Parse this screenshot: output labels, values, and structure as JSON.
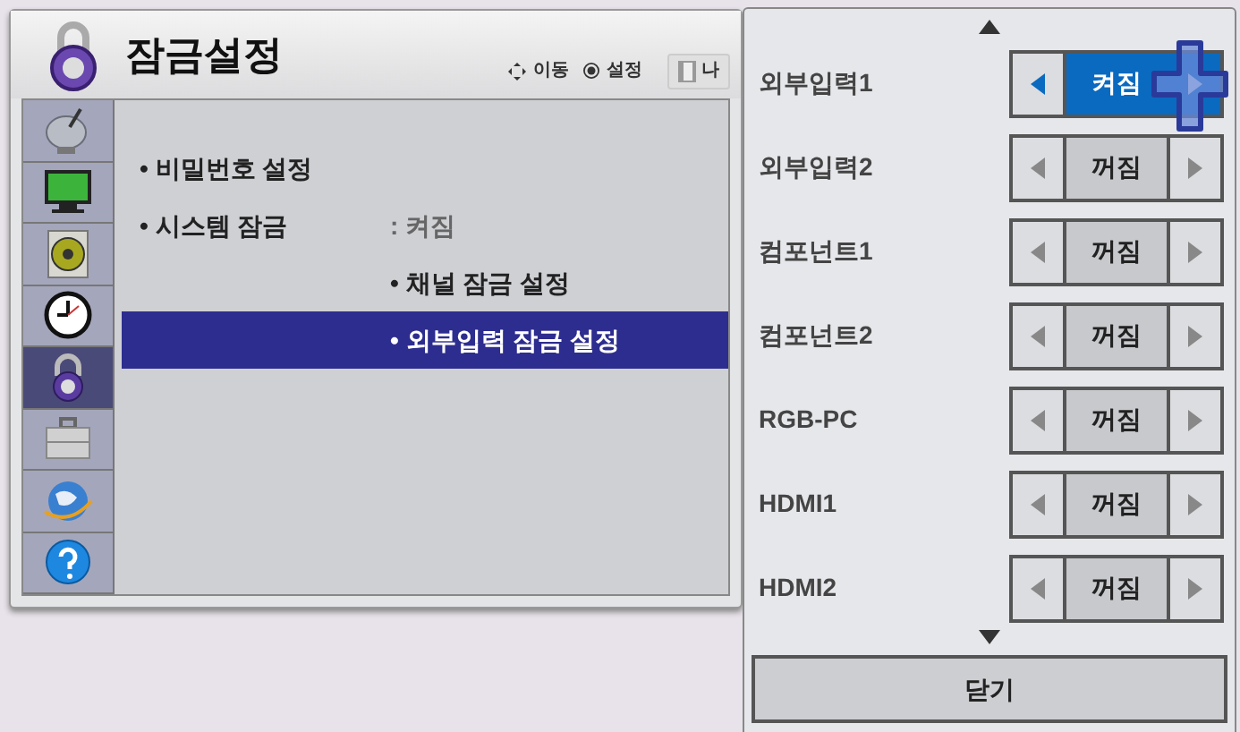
{
  "window": {
    "title": "잠금설정"
  },
  "hints": [
    {
      "kind": "move",
      "label": "이동"
    },
    {
      "kind": "set",
      "label": "설정"
    }
  ],
  "exit_button": {
    "label": "나"
  },
  "sidebar": {
    "items": [
      {
        "kind": "satellite",
        "selected": false
      },
      {
        "kind": "tv",
        "selected": false
      },
      {
        "kind": "speaker",
        "selected": false
      },
      {
        "kind": "clock",
        "selected": false
      },
      {
        "kind": "lock",
        "selected": true
      },
      {
        "kind": "toolbox",
        "selected": false
      },
      {
        "kind": "globe",
        "selected": false
      },
      {
        "kind": "help",
        "selected": false
      }
    ]
  },
  "menu": {
    "items": [
      {
        "label": "• 비밀번호 설정",
        "selected": false
      },
      {
        "label": "• 시스템 잠금",
        "value": ": 켜짐",
        "selected": false,
        "children": [
          {
            "label": "• 채널 잠금 설정",
            "selected": false
          },
          {
            "label": "• 외부입력 잠금 설정",
            "selected": true
          }
        ]
      }
    ]
  },
  "popup": {
    "rows": [
      {
        "label": "외부입력1",
        "value": "켜짐",
        "selected": true
      },
      {
        "label": "외부입력2",
        "value": "꺼짐",
        "selected": false
      },
      {
        "label": "컴포넌트1",
        "value": "꺼짐",
        "selected": false
      },
      {
        "label": "컴포넌트2",
        "value": "꺼짐",
        "selected": false
      },
      {
        "label": "RGB-PC",
        "value": "꺼짐",
        "selected": false
      },
      {
        "label": "HDMI1",
        "value": "꺼짐",
        "selected": false
      },
      {
        "label": "HDMI2",
        "value": "꺼짐",
        "selected": false
      }
    ],
    "close_button": "닫기"
  }
}
